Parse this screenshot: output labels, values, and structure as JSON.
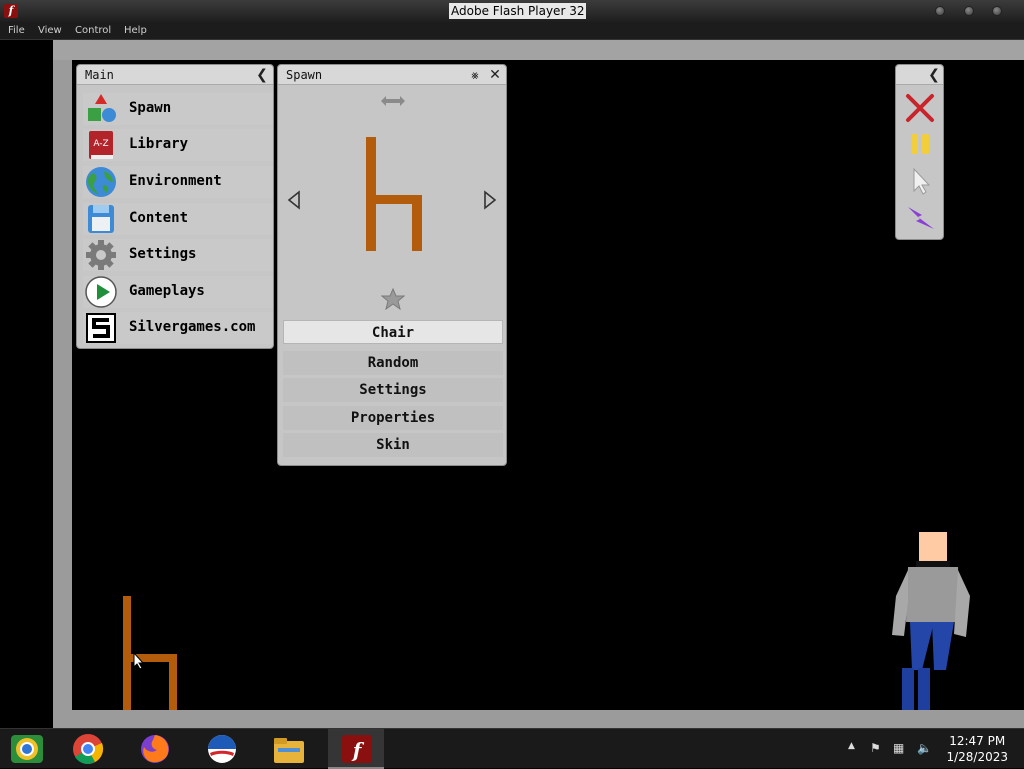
{
  "window": {
    "title": "Adobe Flash Player 32",
    "app_icon": "flash-icon"
  },
  "menu": {
    "items": [
      "File",
      "View",
      "Control",
      "Help"
    ]
  },
  "main_panel": {
    "title": "Main",
    "items": [
      {
        "label": "Spawn",
        "icon": "shapes-icon"
      },
      {
        "label": "Library",
        "icon": "book-icon"
      },
      {
        "label": "Environment",
        "icon": "globe-icon"
      },
      {
        "label": "Content",
        "icon": "floppy-icon"
      },
      {
        "label": "Settings",
        "icon": "gear-icon"
      },
      {
        "label": "Gameplays",
        "icon": "play-icon"
      },
      {
        "label": "Silvergames.com",
        "icon": "silvergames-logo-icon"
      }
    ]
  },
  "spawn_panel": {
    "title": "Spawn",
    "selected": "Chair",
    "options": [
      "Random",
      "Settings",
      "Properties",
      "Skin"
    ]
  },
  "toolbar": {
    "tools": [
      "close-x-icon",
      "pause-icon",
      "cursor-icon",
      "lightning-icon"
    ]
  },
  "taskbar": {
    "apps": [
      "chrome-canary-icon",
      "chrome-icon",
      "firefox-icon",
      "obama-logo-icon",
      "file-explorer-icon",
      "flash-player-icon"
    ],
    "time": "12:47 PM",
    "date": "1/28/2023"
  },
  "colors": {
    "chair": "#b35d0c",
    "stage": "#000000",
    "panel": "#c6c6c6"
  }
}
